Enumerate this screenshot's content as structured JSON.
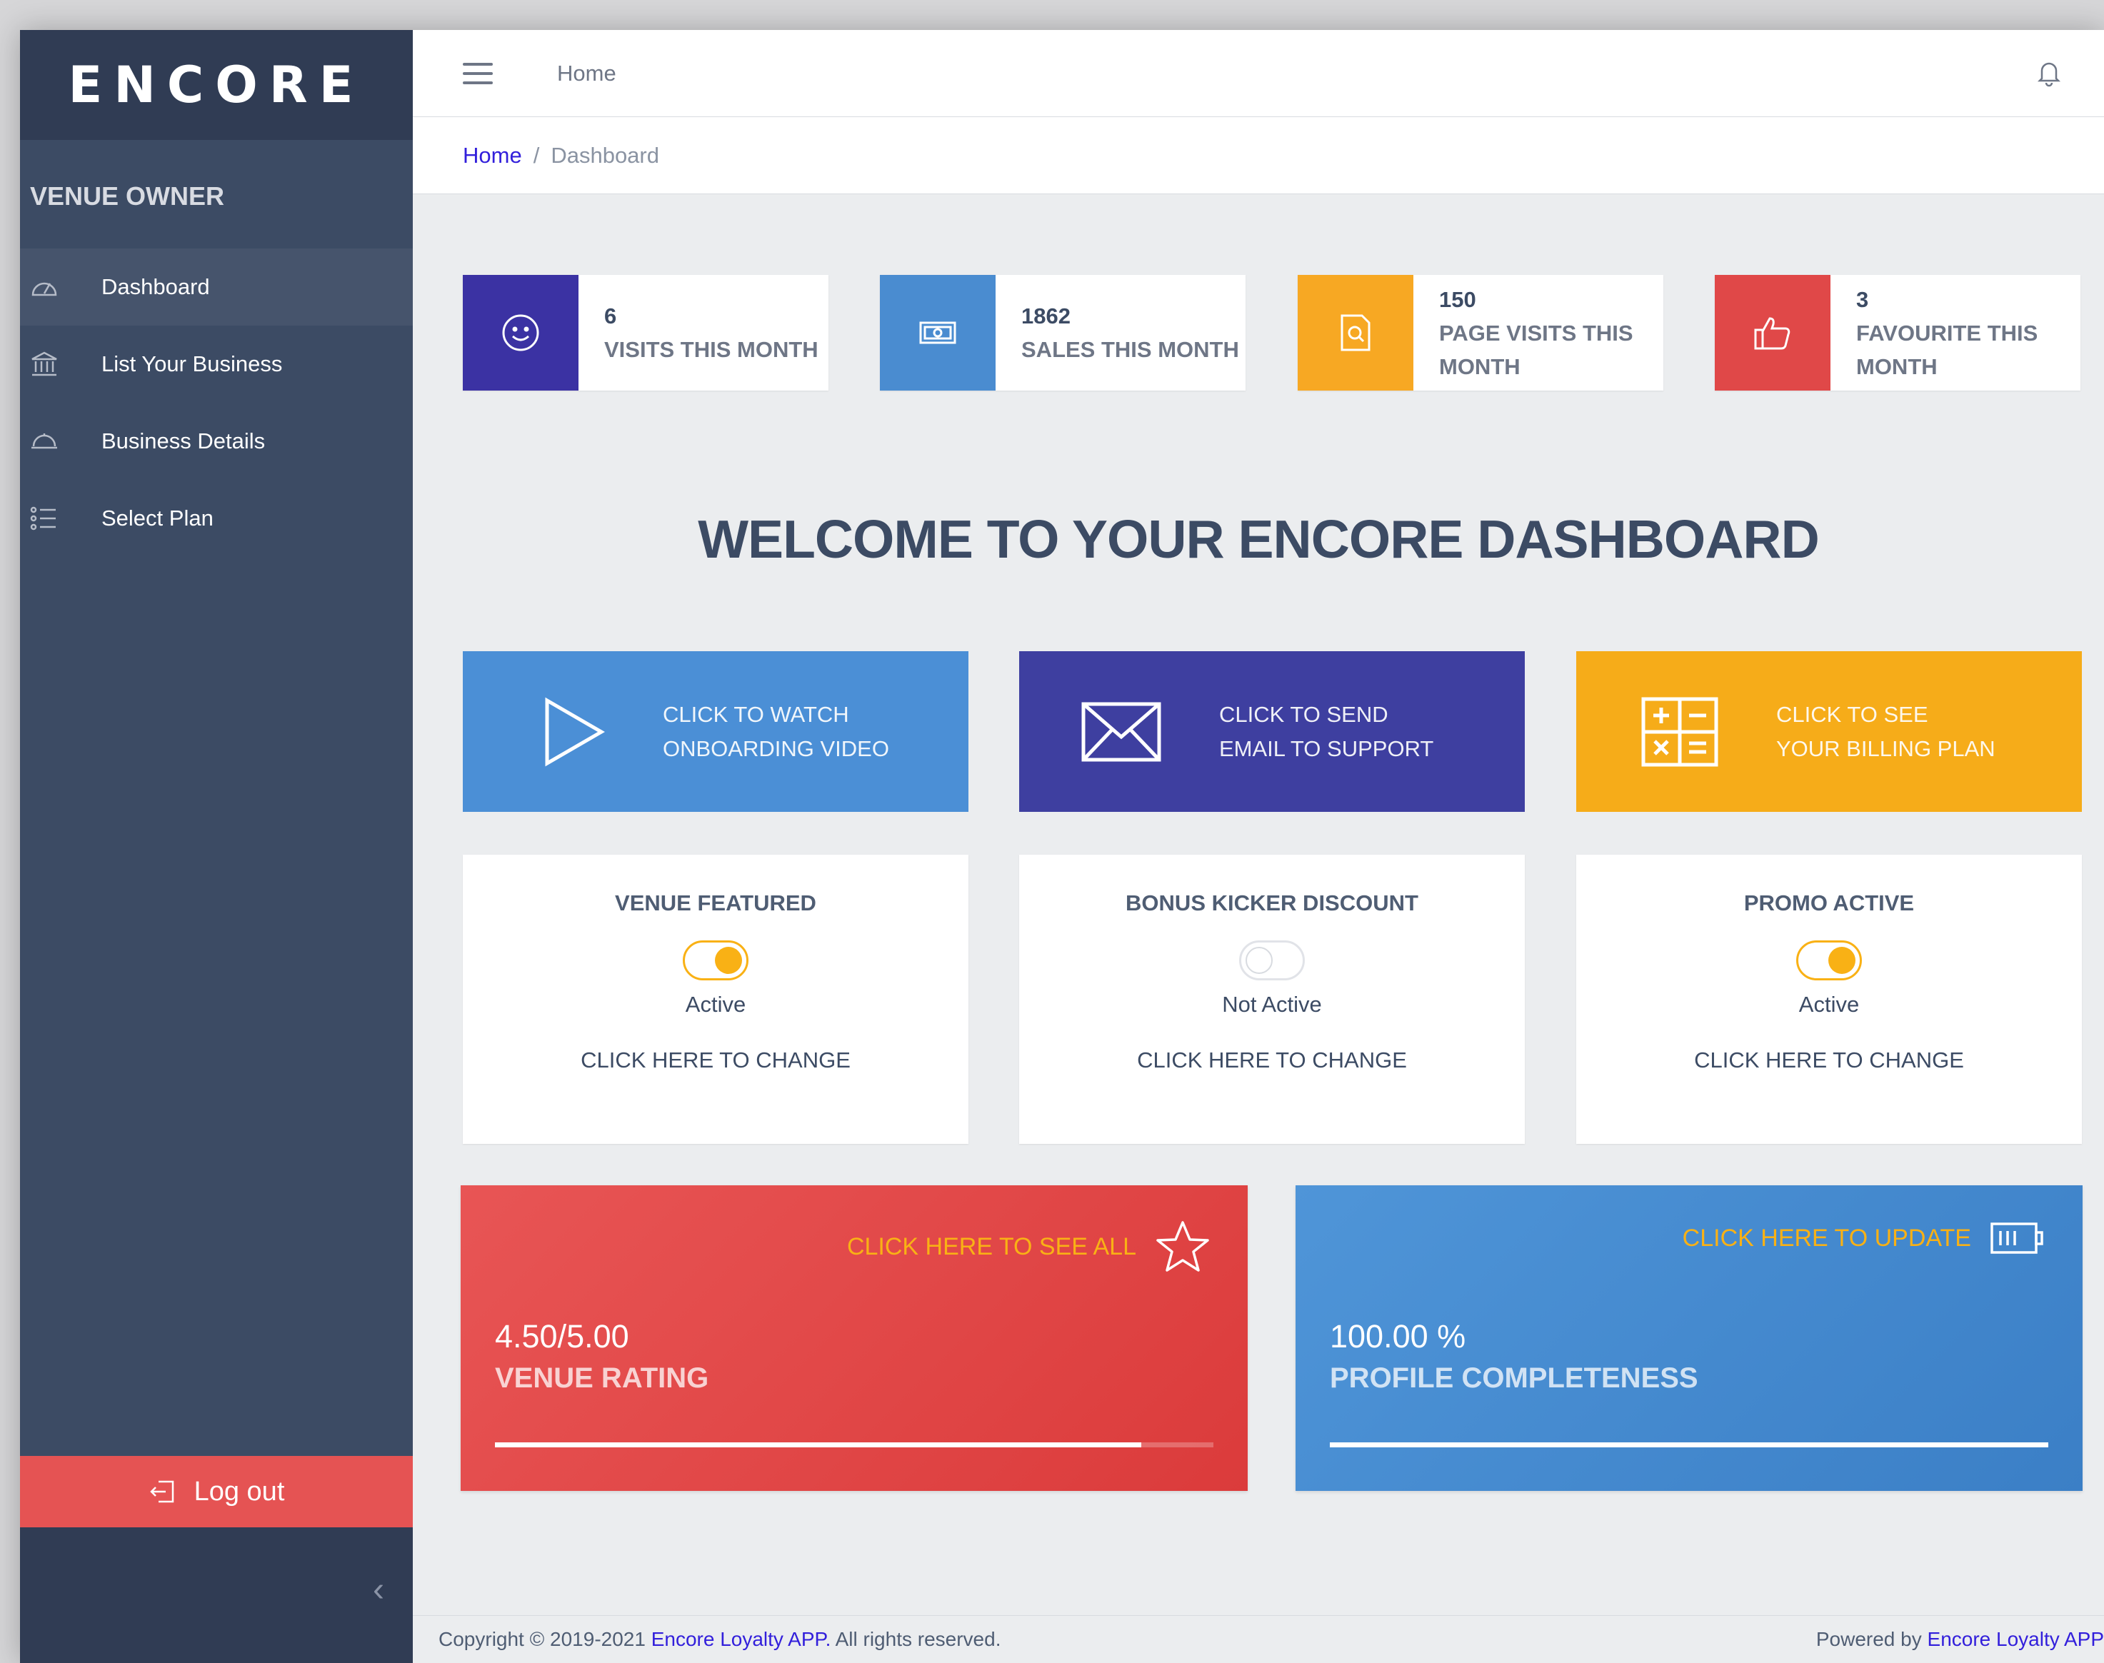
{
  "brand": "ENCORE",
  "sidebar": {
    "title": "VENUE OWNER",
    "items": [
      {
        "label": "Dashboard",
        "icon": "speedometer-icon",
        "active": true
      },
      {
        "label": "List Your Business",
        "icon": "bank-icon"
      },
      {
        "label": "Business Details",
        "icon": "cloche-icon"
      },
      {
        "label": "Select Plan",
        "icon": "list-icon"
      }
    ],
    "logout": "Log out"
  },
  "header": {
    "home": "Home"
  },
  "breadcrumb": {
    "home": "Home",
    "separator": "/",
    "current": "Dashboard"
  },
  "stats": [
    {
      "value": "6",
      "caption": "VISITS THIS MONTH",
      "color": "#3b32a3",
      "icon": "smile-icon"
    },
    {
      "value": "1862",
      "caption": "SALES THIS MONTH",
      "color": "#4a8cd0",
      "icon": "money-icon"
    },
    {
      "value": "150",
      "caption_1": "PAGE VISITS THIS",
      "caption_2": "MONTH",
      "color": "#f7a823",
      "icon": "search-document-icon"
    },
    {
      "value": "3",
      "caption_1": "FAVOURITE THIS",
      "caption_2": "MONTH",
      "color": "#e04848",
      "icon": "thumbs-up-icon"
    }
  ],
  "welcome": "WELCOME TO YOUR ENCORE DASHBOARD",
  "actions": [
    {
      "line1": "CLICK TO WATCH",
      "line2": "ONBOARDING VIDEO",
      "color": "#4b8fd6",
      "icon": "play-icon"
    },
    {
      "line1": "CLICK TO SEND",
      "line2": "EMAIL TO SUPPORT",
      "color": "#3e3fa0",
      "icon": "envelope-icon"
    },
    {
      "line1": "CLICK TO SEE",
      "line2": "YOUR BILLING PLAN",
      "color": "#f6ac19",
      "icon": "calculator-icon"
    }
  ],
  "toggles": [
    {
      "title": "VENUE FEATURED",
      "status": "Active",
      "on": true,
      "change": "CLICK HERE TO CHANGE"
    },
    {
      "title": "BONUS KICKER DISCOUNT",
      "status": "Not Active",
      "on": false,
      "change": "CLICK HERE TO CHANGE"
    },
    {
      "title": "PROMO ACTIVE",
      "status": "Active",
      "on": true,
      "change": "CLICK HERE TO CHANGE"
    }
  ],
  "rating": {
    "link": "CLICK HERE TO SEE ALL",
    "value": "4.50/5.00",
    "caption": "VENUE RATING",
    "progress": 0.9,
    "color": "#e04848",
    "icon": "star-icon"
  },
  "profile": {
    "link": "CLICK HERE TO UPDATE",
    "value": "100.00 %",
    "caption": "PROFILE COMPLETENESS",
    "progress": 1.0,
    "color": "#4a8cd0",
    "icon": "battery-icon"
  },
  "footer": {
    "left_text": "Copyright © 2019-2021",
    "left_link": "Encore Loyalty APP.",
    "left_suffix": "All rights reserved.",
    "right_text": "Powered by",
    "right_link": "Encore Loyalty APP"
  }
}
